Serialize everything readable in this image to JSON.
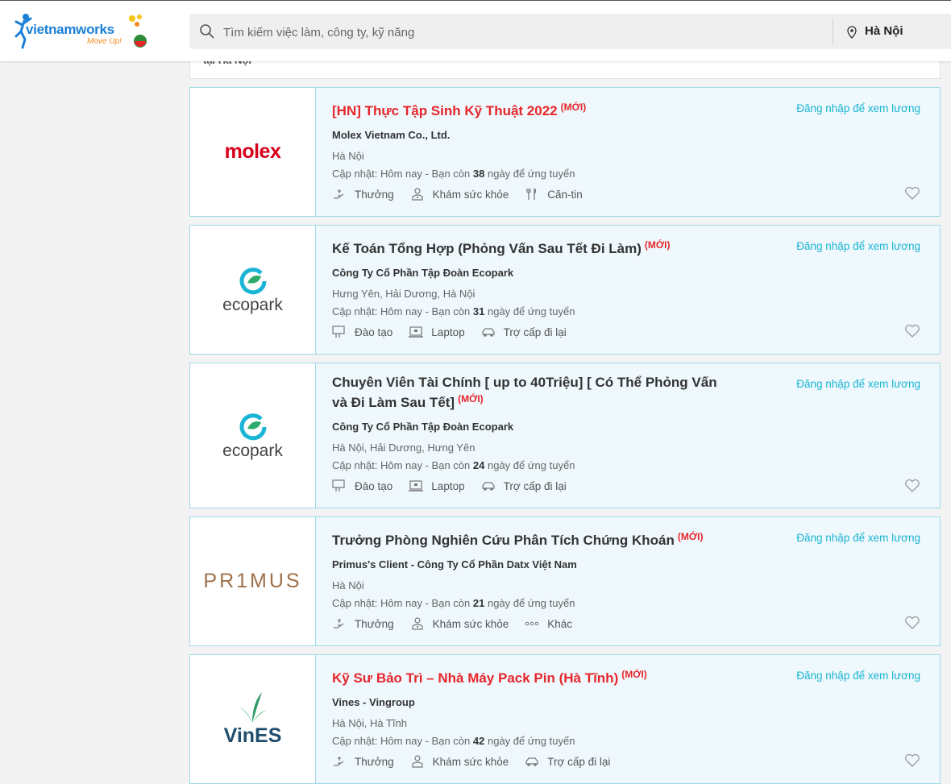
{
  "header": {
    "logo_text": "vietnamworks",
    "logo_tagline": "Move Up!",
    "search_placeholder": "Tìm kiếm việc làm, công ty, kỹ năng",
    "location": "Hà Nội"
  },
  "prev_card_text": "tại Hà Nội",
  "jobs": [
    {
      "title": "[HN] Thực Tập Sinh Kỹ Thuật 2022",
      "new_tag": "(MỚI)",
      "salary": "Đăng nhập để xem lương",
      "company": "Molex Vietnam Co., Ltd.",
      "location": "Hà Nội",
      "updated_prefix": "Cập nhật: Hôm nay - Bạn còn",
      "days": "38",
      "updated_suffix": "ngày để ứng tuyển",
      "logo_text": "molex",
      "benefits": [
        "Thưởng",
        "Khám sức khỏe",
        "Căn-tin"
      ]
    },
    {
      "title": "Kế Toán Tổng Hợp (Phỏng Vấn Sau Tết Đi Làm)",
      "new_tag": "(MỚI)",
      "salary": "Đăng nhập để xem lương",
      "company": "Công Ty Cổ Phần Tập Đoàn Ecopark",
      "location": "Hưng Yên, Hải Dương, Hà Nội",
      "updated_prefix": "Cập nhật: Hôm nay - Bạn còn",
      "days": "31",
      "updated_suffix": "ngày để ứng tuyển",
      "logo_text": "ecopark",
      "benefits": [
        "Đào tạo",
        "Laptop",
        "Trợ cấp đi lại"
      ]
    },
    {
      "title": "Chuyên Viên Tài Chính [ up to 40Triệu] [ Có Thể Phỏng Vấn và Đi Làm Sau Tết]",
      "new_tag": "(MỚI)",
      "salary": "Đăng nhập để xem lương",
      "company": "Công Ty Cổ Phần Tập Đoàn Ecopark",
      "location": "Hà Nội, Hải Dương, Hưng Yên",
      "updated_prefix": "Cập nhật: Hôm nay - Bạn còn",
      "days": "24",
      "updated_suffix": "ngày để ứng tuyển",
      "logo_text": "ecopark",
      "benefits": [
        "Đào tạo",
        "Laptop",
        "Trợ cấp đi lại"
      ]
    },
    {
      "title": "Trưởng Phòng Nghiên Cứu Phân Tích Chứng Khoán",
      "new_tag": "(MỚI)",
      "salary": "Đăng nhập để xem lương",
      "company": "Primus's Client - Công Ty Cổ Phần Datx Việt Nam",
      "location": "Hà Nội",
      "updated_prefix": "Cập nhật: Hôm nay - Bạn còn",
      "days": "21",
      "updated_suffix": "ngày để ứng tuyển",
      "logo_text": "PR1MUS",
      "benefits": [
        "Thưởng",
        "Khám sức khỏe",
        "Khác"
      ]
    },
    {
      "title": "Kỹ Sư Bảo Trì – Nhà Máy Pack Pin (Hà Tĩnh)",
      "new_tag": "(MỚI)",
      "salary": "Đăng nhập để xem lương",
      "company": "Vines - Vingroup",
      "location": "Hà Nội, Hà Tĩnh",
      "updated_prefix": "Cập nhật: Hôm nay - Bạn còn",
      "days": "42",
      "updated_suffix": "ngày để ứng tuyển",
      "logo_text": "VinES",
      "benefits": [
        "Thưởng",
        "Khám sức khỏe",
        "Trợ cấp đi lại"
      ]
    }
  ]
}
